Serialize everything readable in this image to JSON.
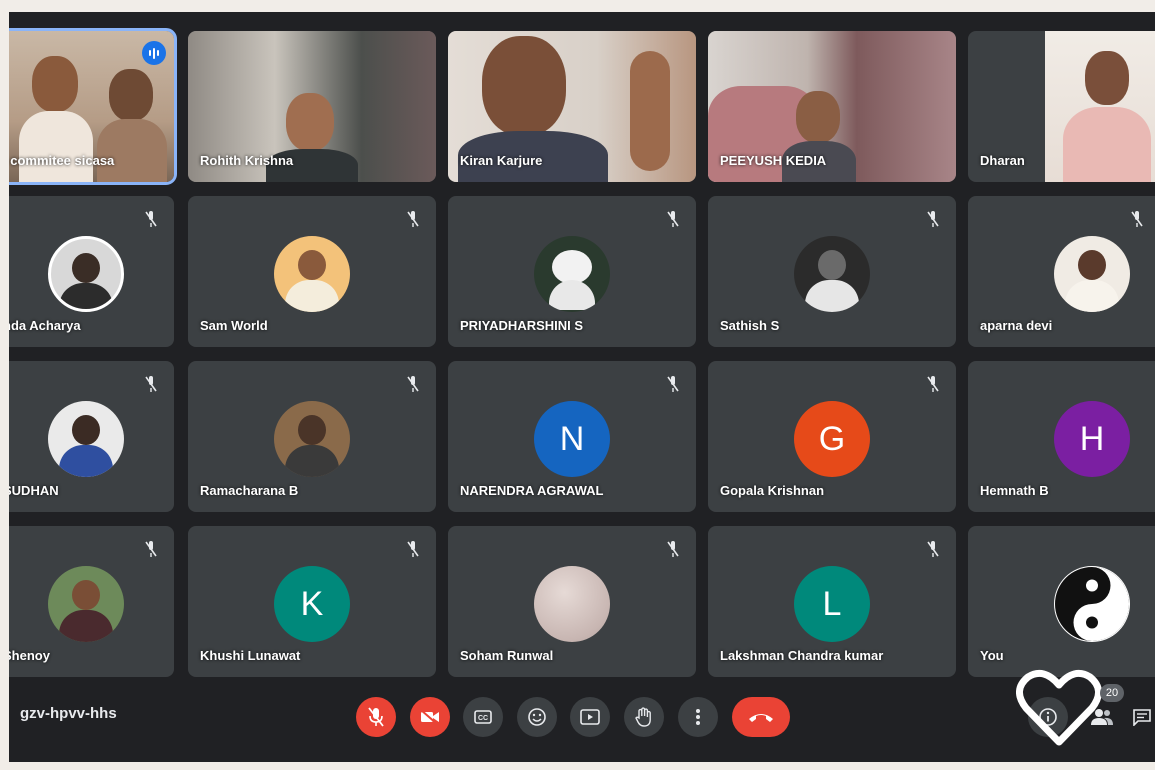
{
  "meeting": {
    "code": "gzv-hpvv-hhs",
    "participant_count": "20"
  },
  "participants": [
    {
      "name": "i commitee sicasa",
      "kind": "video"
    },
    {
      "name": "Rohith Krishna",
      "kind": "video"
    },
    {
      "name": "Kiran Karjure",
      "kind": "video"
    },
    {
      "name": "PEEYUSH KEDIA",
      "kind": "video"
    },
    {
      "name": "Dharan",
      "kind": "video"
    },
    {
      "name": "nda Acharya",
      "kind": "photo"
    },
    {
      "name": "Sam World",
      "kind": "photo"
    },
    {
      "name": "PRIYADHARSHINI S",
      "kind": "photo"
    },
    {
      "name": "Sathish S",
      "kind": "photo"
    },
    {
      "name": "aparna devi",
      "kind": "photo"
    },
    {
      "name": "SUDHAN",
      "kind": "photo"
    },
    {
      "name": "Ramacharana B",
      "kind": "photo"
    },
    {
      "name": "NARENDRA AGRAWAL",
      "kind": "letter",
      "initial": "N",
      "color": "#1565c0"
    },
    {
      "name": "Gopala Krishnan",
      "kind": "letter",
      "initial": "G",
      "color": "#e64a19"
    },
    {
      "name": "Hemnath B",
      "kind": "letter",
      "initial": "H",
      "color": "#7b1fa2"
    },
    {
      "name": "Shenoy",
      "kind": "photo"
    },
    {
      "name": "Khushi Lunawat",
      "kind": "letter",
      "initial": "K",
      "color": "#00897b"
    },
    {
      "name": "Soham Runwal",
      "kind": "photo"
    },
    {
      "name": "Lakshman Chandra kumar",
      "kind": "letter",
      "initial": "L",
      "color": "#00897b"
    },
    {
      "name": "You",
      "kind": "photo"
    }
  ],
  "controls": [
    {
      "name": "mic-off-button",
      "icon": "mic-off-icon",
      "style": "red"
    },
    {
      "name": "camera-off-button",
      "icon": "camera-off-icon",
      "style": "red"
    },
    {
      "name": "captions-button",
      "icon": "captions-icon",
      "style": "normal"
    },
    {
      "name": "emoji-button",
      "icon": "emoji-icon",
      "style": "normal"
    },
    {
      "name": "present-button",
      "icon": "present-icon",
      "style": "normal"
    },
    {
      "name": "raise-hand-button",
      "icon": "hand-icon",
      "style": "normal"
    },
    {
      "name": "more-options-button",
      "icon": "more-vert-icon",
      "style": "normal"
    },
    {
      "name": "leave-call-button",
      "icon": "hang-up-icon",
      "style": "hang"
    }
  ],
  "colors": {
    "background": "#202124",
    "tile": "#3c4043",
    "danger": "#ea4335",
    "speaking": "#1a73e8"
  }
}
